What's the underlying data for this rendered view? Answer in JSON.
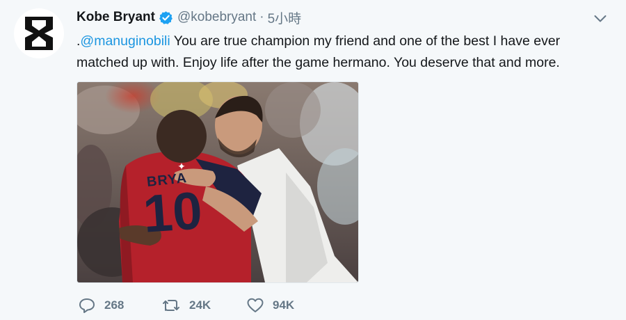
{
  "tweet": {
    "author": {
      "name": "Kobe Bryant",
      "handle": "@kobebryant",
      "verified": true,
      "avatar_icon": "hourglass-logo-icon"
    },
    "separator": "·",
    "time": "5小時",
    "text": {
      "prefix": ".",
      "mention": "@manuginobili",
      "body": " You are true champion my friend and one of the best I have ever matched up with. Enjoy life after the game hermano. You deserve that and more."
    },
    "media": {
      "jersey_letters": "BRYA",
      "jersey_number": "10"
    },
    "stats": {
      "replies": "268",
      "retweets": "24K",
      "likes": "94K"
    }
  },
  "colors": {
    "link": "#1b95e0",
    "muted": "#657786",
    "verified": "#1da1f2",
    "jersey_red": "#b5212b"
  },
  "icons": {
    "reply": "reply-icon",
    "retweet": "retweet-icon",
    "like": "heart-icon",
    "menu": "chevron-down-icon",
    "verified": "verified-badge-icon"
  }
}
